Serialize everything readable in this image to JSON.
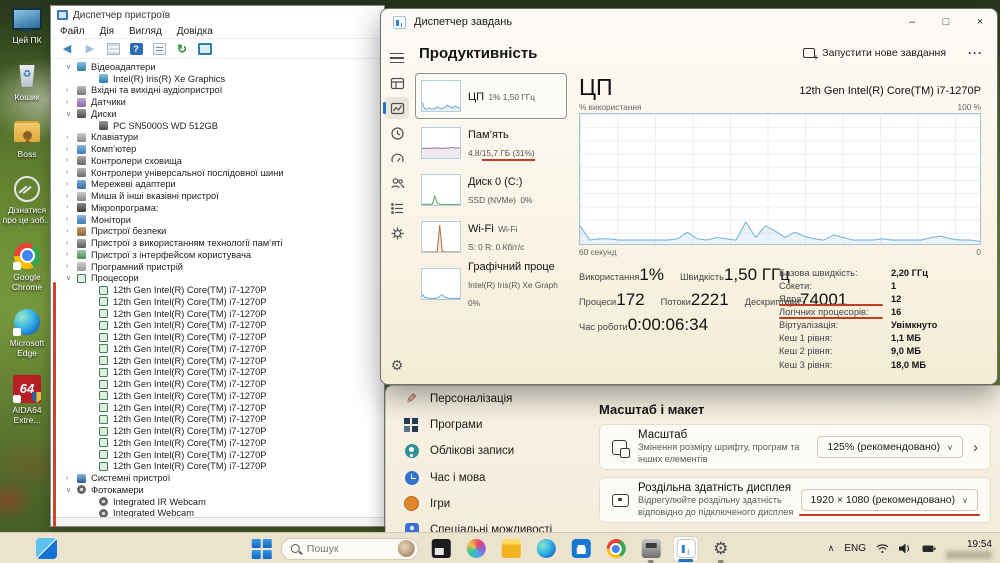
{
  "accent": {
    "red_annotation": "#c23b22",
    "blue": "#1b74c8",
    "graph_line": "#7fb3d5"
  },
  "desktop": {
    "icons": [
      {
        "name": "this-pc-icon",
        "icon": "this-pc",
        "label": "Цей ПК",
        "shortcut": false
      },
      {
        "name": "recycle-bin-icon",
        "icon": "recycle-bin",
        "label": "Кошик",
        "shortcut": false
      },
      {
        "name": "boss-folder-icon",
        "icon": "folder-user",
        "label": "Boss",
        "shortcut": false
      },
      {
        "name": "learn-about-image-icon",
        "icon": "learn-image",
        "label": "Дізнатися про це зоб...",
        "shortcut": false
      },
      {
        "name": "google-chrome-icon",
        "icon": "chrome",
        "label": "Google Chrome",
        "shortcut": true
      },
      {
        "name": "microsoft-edge-icon",
        "icon": "edge",
        "label": "Microsoft Edge",
        "shortcut": true
      },
      {
        "name": "aida64-icon",
        "icon": "aida64",
        "label": "AIDA64 Extre...",
        "shortcut": true
      }
    ]
  },
  "device_manager": {
    "title": "Диспетчер пристроїв",
    "menu": [
      {
        "label": "Файл"
      },
      {
        "label": "Дія"
      },
      {
        "label": "Вигляд"
      },
      {
        "label": "Довідка"
      }
    ],
    "tree": [
      {
        "arrow": "∨",
        "level": 0,
        "icon": "display",
        "label": "Відеоадаптери"
      },
      {
        "arrow": "",
        "level": 1,
        "icon": "display",
        "label": "Intel(R) Iris(R) Xe Graphics"
      },
      {
        "arrow": "›",
        "level": 0,
        "icon": "audio",
        "label": "Вхідні та вихідні аудіопристрої"
      },
      {
        "arrow": "›",
        "level": 0,
        "icon": "sensor",
        "label": "Датчики"
      },
      {
        "arrow": "∨",
        "level": 0,
        "icon": "disk",
        "label": "Диски"
      },
      {
        "arrow": "",
        "level": 1,
        "icon": "disk",
        "label": "PC SN5000S WD 512GB"
      },
      {
        "arrow": "›",
        "level": 0,
        "icon": "keyboard",
        "label": "Клавіатури"
      },
      {
        "arrow": "›",
        "level": 0,
        "icon": "computer",
        "label": "Комп’ютер"
      },
      {
        "arrow": "›",
        "level": 0,
        "icon": "storage",
        "label": "Контролери сховища"
      },
      {
        "arrow": "›",
        "level": 0,
        "icon": "usb",
        "label": "Контролери універсальної послідовної шини"
      },
      {
        "arrow": "›",
        "level": 0,
        "icon": "network",
        "label": "Мережеві адаптери"
      },
      {
        "arrow": "›",
        "level": 0,
        "icon": "mouse",
        "label": "Миша й інші вказівні пристрої"
      },
      {
        "arrow": "›",
        "level": 0,
        "icon": "firmware",
        "label": "Мікропрограма:"
      },
      {
        "arrow": "›",
        "level": 0,
        "icon": "monitor",
        "label": "Монітори"
      },
      {
        "arrow": "›",
        "level": 0,
        "icon": "security",
        "label": "Пристрої безпеки"
      },
      {
        "arrow": "›",
        "level": 0,
        "icon": "memory-tech",
        "label": "Пристрої з використанням технології пам’яті"
      },
      {
        "arrow": "›",
        "level": 0,
        "icon": "hid",
        "label": "Пристрої з інтерфейсом користувача"
      },
      {
        "arrow": "›",
        "level": 0,
        "icon": "software",
        "label": "Програмний пристрій"
      },
      {
        "arrow": "∨",
        "level": 0,
        "icon": "cpu",
        "label": "Процесори"
      },
      {
        "arrow": "",
        "level": 1,
        "icon": "cpu",
        "label": "12th Gen Intel(R) Core(TM) i7-1270P"
      },
      {
        "arrow": "",
        "level": 1,
        "icon": "cpu",
        "label": "12th Gen Intel(R) Core(TM) i7-1270P"
      },
      {
        "arrow": "",
        "level": 1,
        "icon": "cpu",
        "label": "12th Gen Intel(R) Core(TM) i7-1270P"
      },
      {
        "arrow": "",
        "level": 1,
        "icon": "cpu",
        "label": "12th Gen Intel(R) Core(TM) i7-1270P"
      },
      {
        "arrow": "",
        "level": 1,
        "icon": "cpu",
        "label": "12th Gen Intel(R) Core(TM) i7-1270P"
      },
      {
        "arrow": "",
        "level": 1,
        "icon": "cpu",
        "label": "12th Gen Intel(R) Core(TM) i7-1270P"
      },
      {
        "arrow": "",
        "level": 1,
        "icon": "cpu",
        "label": "12th Gen Intel(R) Core(TM) i7-1270P"
      },
      {
        "arrow": "",
        "level": 1,
        "icon": "cpu",
        "label": "12th Gen Intel(R) Core(TM) i7-1270P"
      },
      {
        "arrow": "",
        "level": 1,
        "icon": "cpu",
        "label": "12th Gen Intel(R) Core(TM) i7-1270P"
      },
      {
        "arrow": "",
        "level": 1,
        "icon": "cpu",
        "label": "12th Gen Intel(R) Core(TM) i7-1270P"
      },
      {
        "arrow": "",
        "level": 1,
        "icon": "cpu",
        "label": "12th Gen Intel(R) Core(TM) i7-1270P"
      },
      {
        "arrow": "",
        "level": 1,
        "icon": "cpu",
        "label": "12th Gen Intel(R) Core(TM) i7-1270P"
      },
      {
        "arrow": "",
        "level": 1,
        "icon": "cpu",
        "label": "12th Gen Intel(R) Core(TM) i7-1270P"
      },
      {
        "arrow": "",
        "level": 1,
        "icon": "cpu",
        "label": "12th Gen Intel(R) Core(TM) i7-1270P"
      },
      {
        "arrow": "",
        "level": 1,
        "icon": "cpu",
        "label": "12th Gen Intel(R) Core(TM) i7-1270P"
      },
      {
        "arrow": "",
        "level": 1,
        "icon": "cpu",
        "label": "12th Gen Intel(R) Core(TM) i7-1270P"
      },
      {
        "arrow": "›",
        "level": 0,
        "icon": "system",
        "label": "Системні пристрої"
      },
      {
        "arrow": "∨",
        "level": 0,
        "icon": "camera",
        "label": "Фотокамери"
      },
      {
        "arrow": "",
        "level": 1,
        "icon": "camera",
        "label": "Integrated IR Webcam"
      },
      {
        "arrow": "",
        "level": 1,
        "icon": "camera",
        "label": "Integrated Webcam"
      }
    ]
  },
  "task_manager": {
    "title": "Диспетчер завдань",
    "window_controls": {
      "minimize": "–",
      "maximize": "□",
      "close": "×"
    },
    "page_title": "Продуктивність",
    "run_new_task": "Запустити нове завдання",
    "more": "···",
    "tiles": [
      {
        "name": "ЦП",
        "a": "1%  1,50 ГГц",
        "b": "",
        "c": "",
        "sel": true,
        "color": "#6da8cc",
        "spark": [
          30,
          8,
          6,
          10,
          6,
          8,
          14,
          10,
          8,
          12,
          20,
          14,
          10,
          16,
          12,
          10
        ]
      },
      {
        "name": "Пам’ять",
        "a": "4,8/",
        "b": "15,7 ГБ (31%)",
        "c": "",
        "sel": false,
        "color": "#9a6e9a",
        "spark": [
          32,
          32,
          33,
          32,
          33,
          34,
          33,
          33,
          32,
          33,
          33,
          34,
          35,
          34,
          34,
          34
        ]
      },
      {
        "name": "Диск 0 (C:)",
        "a": "SSD (NVMe)",
        "b": "",
        "c": "0%",
        "sel": false,
        "color": "#66a37a",
        "spark": [
          2,
          2,
          3,
          2,
          2,
          30,
          8,
          3,
          2,
          2,
          2,
          2,
          2,
          2,
          2,
          2
        ]
      },
      {
        "name": "Wi-Fi",
        "a": "Wi-Fi",
        "b": "",
        "c": "S: 0 R: 0 Кбіт/с",
        "sel": false,
        "color": "#a9703c",
        "spark": [
          0,
          0,
          0,
          0,
          0,
          0,
          2,
          90,
          2,
          0,
          0,
          0,
          0,
          0,
          0,
          0
        ]
      },
      {
        "name": "Графічний проце",
        "a": "Intel(R) Iris(R) Xe Graph",
        "b": "",
        "c": "0%",
        "sel": false,
        "color": "#6da8cc",
        "spark": [
          18,
          6,
          4,
          3,
          2,
          2,
          3,
          10,
          14,
          6,
          3,
          2,
          2,
          2,
          2,
          2
        ]
      }
    ],
    "cpu": {
      "title": "ЦП",
      "subtitle": "12th Gen Intel(R) Core(TM) i7-1270P",
      "graph_label": "% використання",
      "graph_max": "100 %",
      "x_left": "60 секунд",
      "x_right": "0",
      "stats_row1": [
        {
          "label": "Використання",
          "value": "1%"
        },
        {
          "label": "Швидкість",
          "value": "1,50 ГГц"
        }
      ],
      "stats_row2": [
        {
          "label": "Процеси",
          "value": "172"
        },
        {
          "label": "Потоки",
          "value": "2221"
        },
        {
          "label": "Дескриптори",
          "value": "74001"
        }
      ],
      "stats_row3": [
        {
          "label": "Час роботи",
          "value": "0:00:06:34"
        }
      ],
      "details": [
        {
          "label": "Базова швидкість:",
          "value": "2,20 ГГц",
          "highlight": false
        },
        {
          "label": "Сокети:",
          "value": "1",
          "highlight": false
        },
        {
          "label": "Ядра:",
          "value": "12",
          "highlight": true
        },
        {
          "label": "Логічних процесорів:",
          "value": "16",
          "highlight": true
        },
        {
          "label": "Віртуалізація:",
          "value": "Увімкнуто",
          "highlight": false
        },
        {
          "label": "Кеш 1 рівня:",
          "value": "1,1 МБ",
          "highlight": false
        },
        {
          "label": "Кеш 2 рівня:",
          "value": "9,0 МБ",
          "highlight": false
        },
        {
          "label": "Кеш 3 рівня:",
          "value": "18,0 МБ",
          "highlight": false
        }
      ]
    }
  },
  "settings": {
    "sidebar": [
      {
        "icon": "personalization",
        "label": "Персоналізація"
      },
      {
        "icon": "apps",
        "label": "Програми"
      },
      {
        "icon": "accounts",
        "label": "Облікові записи"
      },
      {
        "icon": "time",
        "label": "Час і мова"
      },
      {
        "icon": "games",
        "label": "Ігри"
      },
      {
        "icon": "access",
        "label": "Спеціальні можливості"
      }
    ],
    "section_title": "Масштаб і макет",
    "rows": [
      {
        "icon": "scale",
        "title": "Масштаб",
        "desc": "Змінення розміру шрифту, програм та інших елементів",
        "value": "125% (рекомендовано)",
        "highlight": false,
        "arrow": true
      },
      {
        "icon": "resolution",
        "title": "Роздільна здатність дисплея",
        "desc": "Відрегулюйте роздільну здатність відповідно до підключеного дисплея",
        "value": "1920 × 1080 (рекомендовано)",
        "highlight": true,
        "arrow": false
      }
    ]
  },
  "taskbar": {
    "search_placeholder": "Пошук",
    "apps": [
      {
        "name": "task-view-icon",
        "icon": "task-view",
        "run": false,
        "active": false
      },
      {
        "name": "copilot-icon",
        "icon": "copilot",
        "run": false,
        "active": false
      },
      {
        "name": "file-explorer-icon",
        "icon": "explorer",
        "run": false,
        "active": false
      },
      {
        "name": "edge-icon",
        "icon": "edge",
        "run": false,
        "active": false
      },
      {
        "name": "microsoft-store-icon",
        "icon": "store",
        "run": false,
        "active": false
      },
      {
        "name": "chrome-icon",
        "icon": "chrome",
        "run": false,
        "active": false
      },
      {
        "name": "device-manager-icon",
        "icon": "device-manager",
        "run": true,
        "active": false
      },
      {
        "name": "task-manager-icon",
        "icon": "task-manager",
        "run": true,
        "active": true
      },
      {
        "name": "settings-icon",
        "icon": "settings",
        "run": true,
        "active": false
      }
    ],
    "tray": {
      "lang": "ENG",
      "time": "19:54"
    }
  },
  "chart_data": {
    "type": "line",
    "title": "ЦП — % використання",
    "xlabel": "час (60 секунд → 0)",
    "ylabel": "% використання",
    "ylim": [
      0,
      100
    ],
    "x_left_label": "60 секунд",
    "x_right_label": "0",
    "y_max_label": "100 %",
    "grid": true,
    "legend_position": "none",
    "series": [
      {
        "name": "% використання",
        "values": [
          14,
          3,
          4,
          4,
          3,
          3,
          3,
          3,
          3,
          3,
          4,
          9,
          4,
          3,
          5,
          4,
          3,
          17,
          5,
          14,
          10,
          5,
          9,
          6,
          4,
          3,
          7,
          5,
          3,
          3,
          3,
          4,
          3,
          3,
          3,
          3,
          5,
          6,
          4,
          3,
          3,
          2
        ]
      }
    ]
  }
}
